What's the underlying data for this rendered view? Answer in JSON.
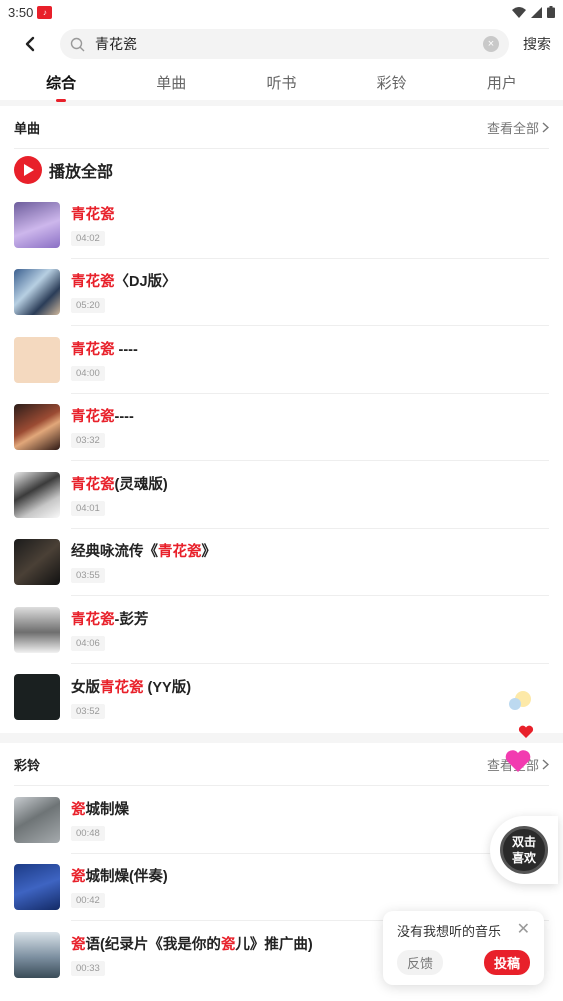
{
  "status": {
    "time": "3:50"
  },
  "search": {
    "query": "青花瓷",
    "button": "搜索"
  },
  "tabs": [
    {
      "label": "综合",
      "active": true
    },
    {
      "label": "单曲",
      "active": false
    },
    {
      "label": "听书",
      "active": false
    },
    {
      "label": "彩铃",
      "active": false
    },
    {
      "label": "用户",
      "active": false
    }
  ],
  "songs_section": {
    "title": "单曲",
    "more": "查看全部",
    "play_all": "播放全部",
    "items": [
      {
        "pre": "",
        "hl": "青花瓷",
        "post": "",
        "duration": "04:02"
      },
      {
        "pre": "",
        "hl": "青花瓷",
        "post": "〈DJ版〉",
        "duration": "05:20"
      },
      {
        "pre": "",
        "hl": "青花瓷",
        "post": " ----",
        "duration": "04:00"
      },
      {
        "pre": "",
        "hl": "青花瓷",
        "post": "----",
        "duration": "03:32"
      },
      {
        "pre": "",
        "hl": "青花瓷",
        "post": "(灵魂版)",
        "duration": "04:01"
      },
      {
        "pre": "经典咏流传《",
        "hl": "青花瓷",
        "post": "》",
        "duration": "03:55"
      },
      {
        "pre": "",
        "hl": "青花瓷",
        "post": "-彭芳",
        "duration": "04:06"
      },
      {
        "pre": "女版",
        "hl": "青花瓷",
        "post": " (YY版)",
        "duration": "03:52"
      }
    ]
  },
  "ringtone_section": {
    "title": "彩铃",
    "more": "查看全部",
    "items": [
      {
        "pre": "",
        "hl": "瓷",
        "post": "城制燥",
        "duration": "00:48"
      },
      {
        "pre": "",
        "hl": "瓷",
        "post": "城制燥(伴奏)",
        "duration": "00:42"
      },
      {
        "pre": "",
        "hl": "瓷",
        "post": "语(纪录片《我是你的",
        "hl2": "瓷",
        "post2": "儿》推广曲)",
        "duration": "00:33"
      }
    ]
  },
  "like_float": {
    "line1": "双击",
    "line2": "喜欢"
  },
  "feedback": {
    "title": "没有我想听的音乐",
    "cancel": "反馈",
    "submit": "投稿"
  },
  "colors": {
    "accent": "#e8202a"
  }
}
